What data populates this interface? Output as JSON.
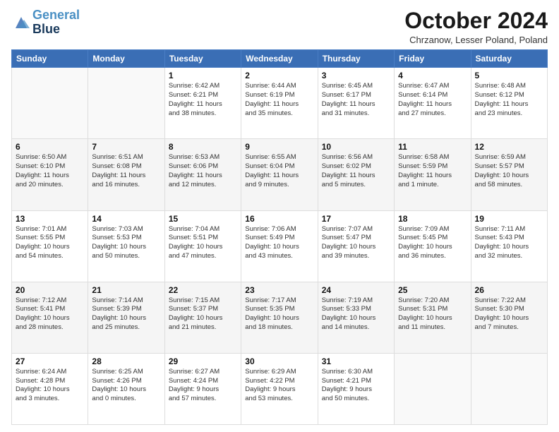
{
  "logo": {
    "line1": "General",
    "line2": "Blue"
  },
  "title": "October 2024",
  "location": "Chrzanow, Lesser Poland, Poland",
  "weekdays": [
    "Sunday",
    "Monday",
    "Tuesday",
    "Wednesday",
    "Thursday",
    "Friday",
    "Saturday"
  ],
  "weeks": [
    [
      {
        "day": "",
        "info": ""
      },
      {
        "day": "",
        "info": ""
      },
      {
        "day": "1",
        "info": "Sunrise: 6:42 AM\nSunset: 6:21 PM\nDaylight: 11 hours\nand 38 minutes."
      },
      {
        "day": "2",
        "info": "Sunrise: 6:44 AM\nSunset: 6:19 PM\nDaylight: 11 hours\nand 35 minutes."
      },
      {
        "day": "3",
        "info": "Sunrise: 6:45 AM\nSunset: 6:17 PM\nDaylight: 11 hours\nand 31 minutes."
      },
      {
        "day": "4",
        "info": "Sunrise: 6:47 AM\nSunset: 6:14 PM\nDaylight: 11 hours\nand 27 minutes."
      },
      {
        "day": "5",
        "info": "Sunrise: 6:48 AM\nSunset: 6:12 PM\nDaylight: 11 hours\nand 23 minutes."
      }
    ],
    [
      {
        "day": "6",
        "info": "Sunrise: 6:50 AM\nSunset: 6:10 PM\nDaylight: 11 hours\nand 20 minutes."
      },
      {
        "day": "7",
        "info": "Sunrise: 6:51 AM\nSunset: 6:08 PM\nDaylight: 11 hours\nand 16 minutes."
      },
      {
        "day": "8",
        "info": "Sunrise: 6:53 AM\nSunset: 6:06 PM\nDaylight: 11 hours\nand 12 minutes."
      },
      {
        "day": "9",
        "info": "Sunrise: 6:55 AM\nSunset: 6:04 PM\nDaylight: 11 hours\nand 9 minutes."
      },
      {
        "day": "10",
        "info": "Sunrise: 6:56 AM\nSunset: 6:02 PM\nDaylight: 11 hours\nand 5 minutes."
      },
      {
        "day": "11",
        "info": "Sunrise: 6:58 AM\nSunset: 5:59 PM\nDaylight: 11 hours\nand 1 minute."
      },
      {
        "day": "12",
        "info": "Sunrise: 6:59 AM\nSunset: 5:57 PM\nDaylight: 10 hours\nand 58 minutes."
      }
    ],
    [
      {
        "day": "13",
        "info": "Sunrise: 7:01 AM\nSunset: 5:55 PM\nDaylight: 10 hours\nand 54 minutes."
      },
      {
        "day": "14",
        "info": "Sunrise: 7:03 AM\nSunset: 5:53 PM\nDaylight: 10 hours\nand 50 minutes."
      },
      {
        "day": "15",
        "info": "Sunrise: 7:04 AM\nSunset: 5:51 PM\nDaylight: 10 hours\nand 47 minutes."
      },
      {
        "day": "16",
        "info": "Sunrise: 7:06 AM\nSunset: 5:49 PM\nDaylight: 10 hours\nand 43 minutes."
      },
      {
        "day": "17",
        "info": "Sunrise: 7:07 AM\nSunset: 5:47 PM\nDaylight: 10 hours\nand 39 minutes."
      },
      {
        "day": "18",
        "info": "Sunrise: 7:09 AM\nSunset: 5:45 PM\nDaylight: 10 hours\nand 36 minutes."
      },
      {
        "day": "19",
        "info": "Sunrise: 7:11 AM\nSunset: 5:43 PM\nDaylight: 10 hours\nand 32 minutes."
      }
    ],
    [
      {
        "day": "20",
        "info": "Sunrise: 7:12 AM\nSunset: 5:41 PM\nDaylight: 10 hours\nand 28 minutes."
      },
      {
        "day": "21",
        "info": "Sunrise: 7:14 AM\nSunset: 5:39 PM\nDaylight: 10 hours\nand 25 minutes."
      },
      {
        "day": "22",
        "info": "Sunrise: 7:15 AM\nSunset: 5:37 PM\nDaylight: 10 hours\nand 21 minutes."
      },
      {
        "day": "23",
        "info": "Sunrise: 7:17 AM\nSunset: 5:35 PM\nDaylight: 10 hours\nand 18 minutes."
      },
      {
        "day": "24",
        "info": "Sunrise: 7:19 AM\nSunset: 5:33 PM\nDaylight: 10 hours\nand 14 minutes."
      },
      {
        "day": "25",
        "info": "Sunrise: 7:20 AM\nSunset: 5:31 PM\nDaylight: 10 hours\nand 11 minutes."
      },
      {
        "day": "26",
        "info": "Sunrise: 7:22 AM\nSunset: 5:30 PM\nDaylight: 10 hours\nand 7 minutes."
      }
    ],
    [
      {
        "day": "27",
        "info": "Sunrise: 6:24 AM\nSunset: 4:28 PM\nDaylight: 10 hours\nand 3 minutes."
      },
      {
        "day": "28",
        "info": "Sunrise: 6:25 AM\nSunset: 4:26 PM\nDaylight: 10 hours\nand 0 minutes."
      },
      {
        "day": "29",
        "info": "Sunrise: 6:27 AM\nSunset: 4:24 PM\nDaylight: 9 hours\nand 57 minutes."
      },
      {
        "day": "30",
        "info": "Sunrise: 6:29 AM\nSunset: 4:22 PM\nDaylight: 9 hours\nand 53 minutes."
      },
      {
        "day": "31",
        "info": "Sunrise: 6:30 AM\nSunset: 4:21 PM\nDaylight: 9 hours\nand 50 minutes."
      },
      {
        "day": "",
        "info": ""
      },
      {
        "day": "",
        "info": ""
      }
    ]
  ]
}
